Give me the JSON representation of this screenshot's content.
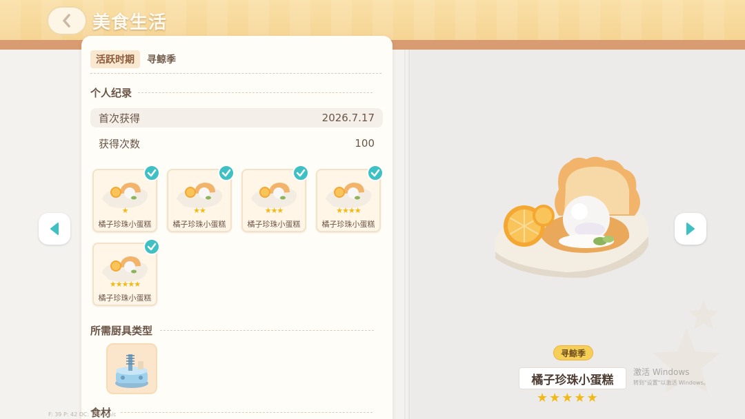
{
  "header": {
    "title": "美食生活"
  },
  "detail": {
    "active_period_label": "活跃时期",
    "active_period_value": "寻鲸季",
    "personal_record_title": "个人纪录",
    "first_obtained_label": "首次获得",
    "first_obtained_value": "2026.7.17",
    "times_obtained_label": "获得次数",
    "times_obtained_value": "100",
    "variants": [
      {
        "name": "橘子珍珠小蛋糕",
        "stars": "★",
        "collected": true
      },
      {
        "name": "橘子珍珠小蛋糕",
        "stars": "★★",
        "collected": true
      },
      {
        "name": "橘子珍珠小蛋糕",
        "stars": "★★★",
        "collected": true
      },
      {
        "name": "橘子珍珠小蛋糕",
        "stars": "★★★★",
        "collected": true
      },
      {
        "name": "橘子珍珠小蛋糕",
        "stars": "★★★★★",
        "collected": true
      }
    ],
    "kitchenware_title": "所需厨具类型",
    "ingredients_title": "食材"
  },
  "showcase": {
    "season_tag": "寻鲸季",
    "dish_name": "橘子珍珠小蛋糕",
    "stars": "★★★★★",
    "star_rating": 5
  },
  "overlay": {
    "watermark_line1": "激活 Windows",
    "watermark_line2": "转到\"设置\"以激活 Windows。",
    "debug_text": "F: 39    P: 42    DC: 150 s/p/c"
  },
  "colors": {
    "accent_teal": "#3fc1c4",
    "star_gold": "#f2b915",
    "banner": "#f8dca0"
  }
}
